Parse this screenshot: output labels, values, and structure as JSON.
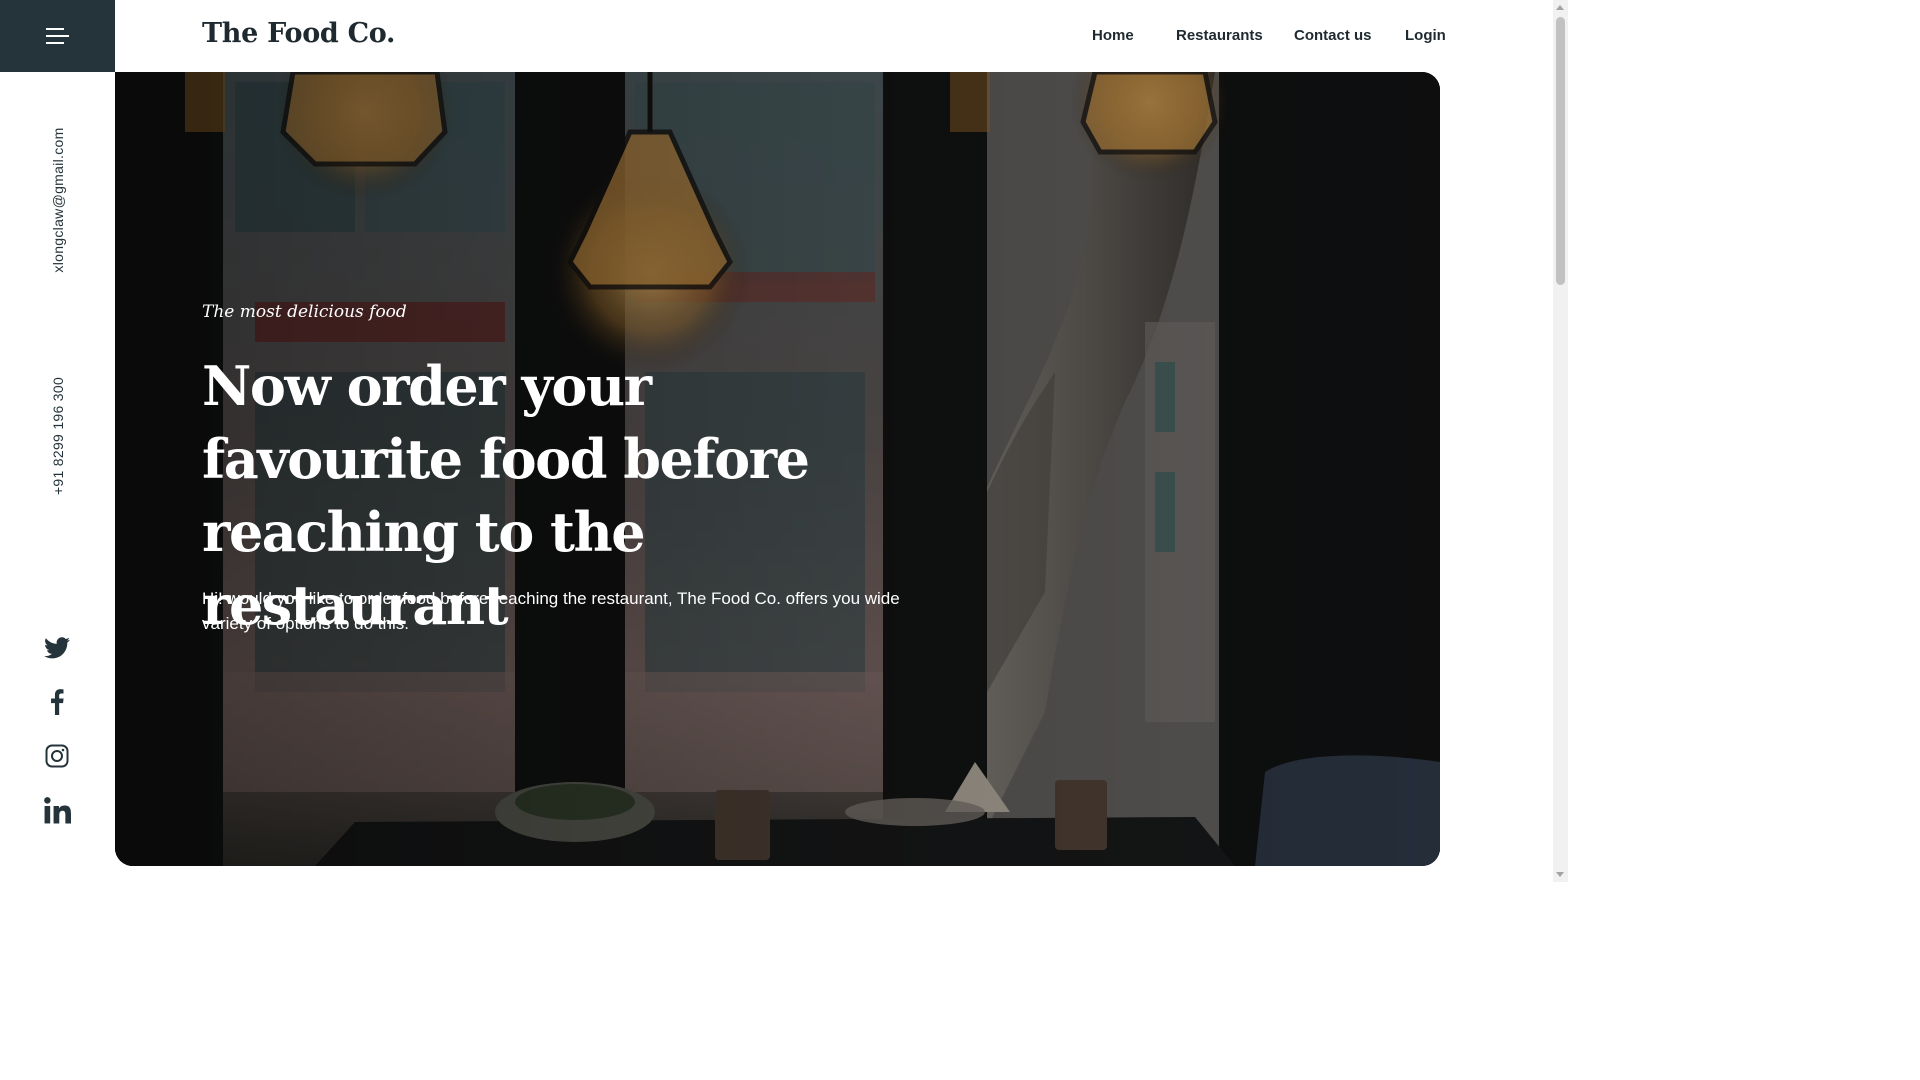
{
  "header": {
    "brand": "The Food Co.",
    "nav": [
      "Home",
      "Restaurants",
      "Contact us",
      "Login"
    ]
  },
  "sidebar": {
    "menu_icon": "hamburger-menu-icon",
    "email": "xlongclaw@gmail.com",
    "phone": "+91 8299 196 300",
    "social": [
      "twitter-icon",
      "facebook-icon",
      "instagram-icon",
      "linkedin-icon"
    ]
  },
  "hero": {
    "tagline": "The most delicious food",
    "headline": "Now order your favourite food before reaching to the restaurant",
    "lead": "Hi! would you like to order food before reaching the restaurant, The Food Co. offers you wide variety of options to do this."
  },
  "colors": {
    "dark": "#25343b",
    "text": "#1f2a30",
    "hero_text": "#ffffff"
  }
}
